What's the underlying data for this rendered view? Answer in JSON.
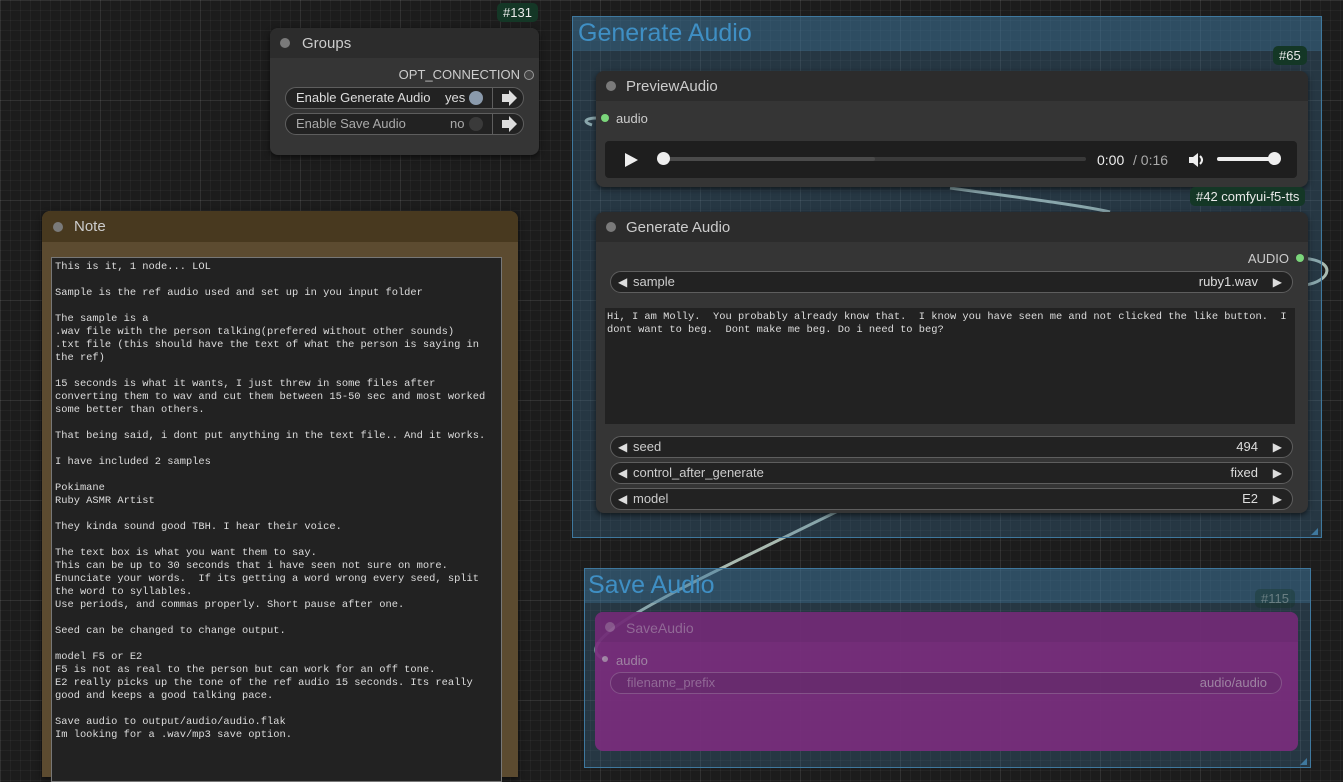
{
  "groups_node": {
    "id_badge": "#131",
    "title": "Groups",
    "output_label": "OPT_CONNECTION",
    "toggles": [
      {
        "label": "Enable Generate Audio",
        "value": "yes"
      },
      {
        "label": "Enable Save Audio",
        "value": "no"
      }
    ]
  },
  "note_node": {
    "title": "Note",
    "text": "This is it, 1 node... LOL\n\nSample is the ref audio used and set up in you input folder\n\nThe sample is a\n.wav file with the person talking(prefered without other sounds)\n.txt file (this should have the text of what the person is saying in the ref)\n\n15 seconds is what it wants, I just threw in some files after converting them to wav and cut them between 15-50 sec and most worked some better than others.\n\nThat being said, i dont put anything in the text file.. And it works.\n\nI have included 2 samples\n\nPokimane\nRuby ASMR Artist\n\nThey kinda sound good TBH. I hear their voice.\n\nThe text box is what you want them to say.\nThis can be up to 30 seconds that i have seen not sure on more.\nEnunciate your words.  If its getting a word wrong every seed, split the word to syllables.\nUse periods, and commas properly. Short pause after one.\n\nSeed can be changed to change output.\n\nmodel F5 or E2\nF5 is not as real to the person but can work for an off tone.\nE2 really picks up the tone of the ref audio 15 seconds. Its really good and keeps a good talking pace.\n\nSave audio to output/audio/audio.flak\nIm looking for a .wav/mp3 save option."
  },
  "generate_group": {
    "title": "Generate Audio",
    "preview_node": {
      "id_badge": "#65",
      "title": "PreviewAudio",
      "input_label": "audio",
      "player": {
        "time": "0:00",
        "duration": "/ 0:16",
        "progress": 0.0,
        "volume": 1.0
      }
    },
    "generate_node": {
      "id_badge": "#42 comfyui-f5-tts",
      "title": "Generate Audio",
      "output_label": "AUDIO",
      "sample": {
        "label": "sample",
        "value": "ruby1.wav"
      },
      "text": "Hi, I am Molly.  You probably already know that.  I know you have seen me and not clicked the like button.  I dont want to beg.  Dont make me beg. Do i need to beg?",
      "seed": {
        "label": "seed",
        "value": "494"
      },
      "control_after_generate": {
        "label": "control_after_generate",
        "value": "fixed"
      },
      "model": {
        "label": "model",
        "value": "E2"
      }
    }
  },
  "save_group": {
    "title": "Save Audio",
    "save_node": {
      "id_badge": "#115",
      "title": "SaveAudio",
      "input_label": "audio",
      "filename_prefix": {
        "label": "filename_prefix",
        "value": "audio/audio"
      }
    }
  },
  "colors": {
    "group_blue": "#3f789e",
    "bypass_purple": "#7a2d7d",
    "note_brown": "#5a4a30",
    "badge_green": "#143726",
    "link_color": "#a9bab0"
  }
}
